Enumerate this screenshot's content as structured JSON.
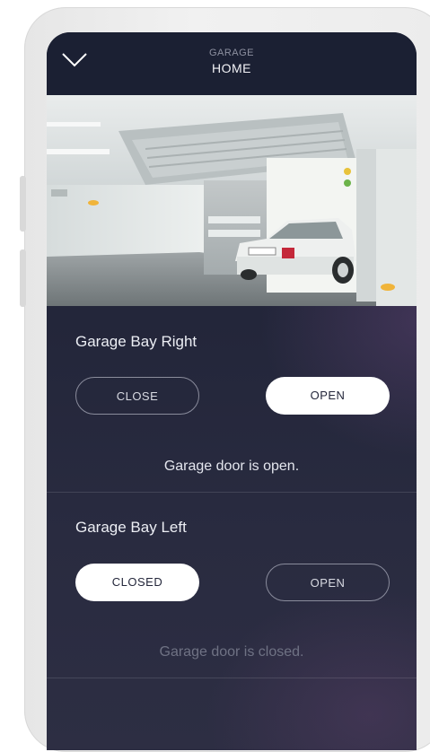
{
  "header": {
    "subtitle": "GARAGE",
    "title": "HOME",
    "back_icon": "chevron-down-icon"
  },
  "camera": {
    "description": "garage-camera-feed"
  },
  "bays": [
    {
      "name": "Garage Bay Right",
      "close_label": "CLOSE",
      "open_label": "OPEN",
      "selected": "open",
      "status": "Garage door is open."
    },
    {
      "name": "Garage Bay Left",
      "close_label": "CLOSED",
      "open_label": "OPEN",
      "selected": "closed",
      "status": "Garage door is closed."
    }
  ],
  "colors": {
    "background": "#23263a",
    "header": "#1b2033",
    "button_active": "#ffffff",
    "button_outline": "#8a8c9c"
  }
}
